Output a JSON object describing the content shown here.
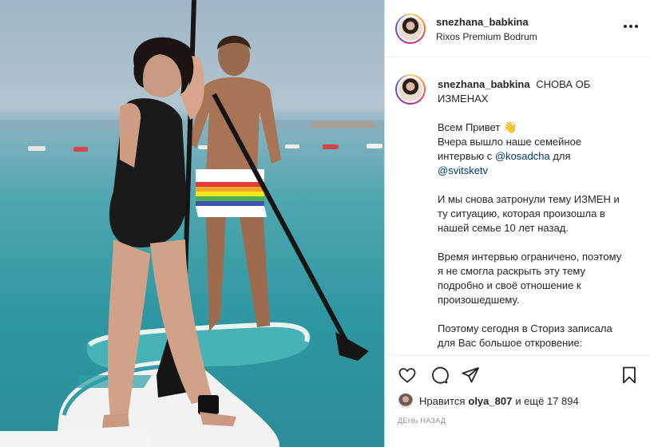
{
  "post": {
    "photo_alt": "",
    "header": {
      "username": "snezhana_babkina",
      "location": "Rixos Premium Bodrum"
    },
    "caption": {
      "username": "snezhana_babkina",
      "title": "СНОВА ОБ ИЗМЕНАХ",
      "greeting": "Всем Привет",
      "greeting_emoji": "👋",
      "line1_pre": "Вчера вышло наше семейное интервью с ",
      "mention1": "@kosadcha",
      "line1_post": " для",
      "mention2": "@svitsketv",
      "paragraph2": "И мы снова затронули тему ИЗМЕН и ту ситуацию, которая произошла в нашей семье 10 лет назад.",
      "paragraph3": "Время интервью ограничено, поэтому я не смогла раскрыть эту тему подробно и своё отношение к произошедшему.",
      "paragraph4": "Поэтому сегодня в Сториз записала для Вас большое откровение:"
    },
    "likes": {
      "prefix": "Нравится",
      "user": "olya_807",
      "suffix": "и ещё 17 894"
    },
    "time": "ДЕНЬ НАЗАД"
  },
  "icons": {
    "more": "more-horizontal-icon",
    "like": "heart-icon",
    "comment": "comment-icon",
    "share": "send-icon",
    "save": "bookmark-icon"
  },
  "colors": {
    "text": "#262626",
    "mention": "#00376b",
    "muted": "#8e8e8e",
    "border": "#dbdbdb"
  }
}
